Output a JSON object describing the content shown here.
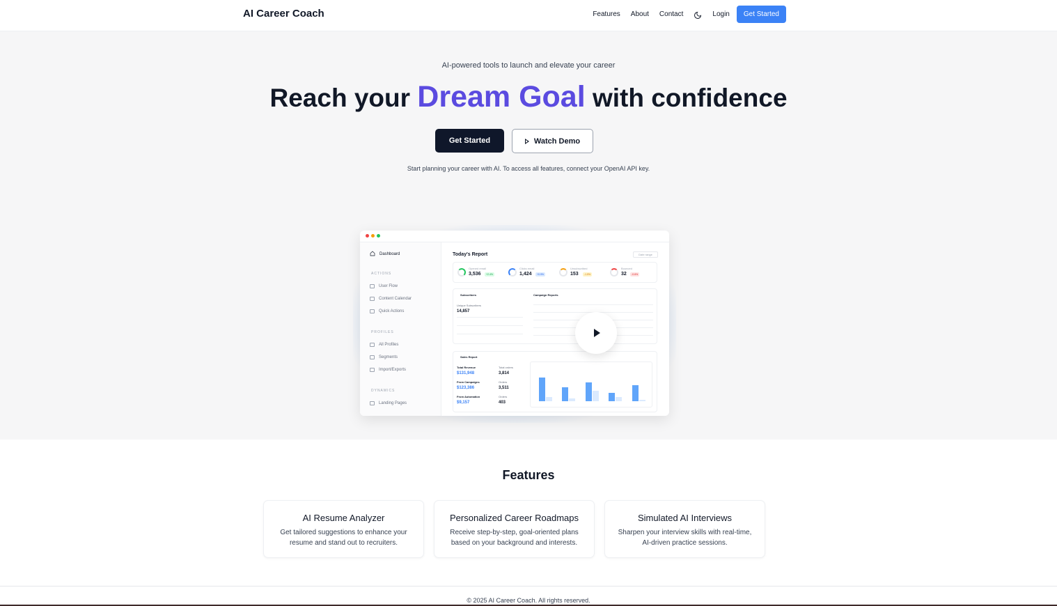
{
  "header": {
    "brand": "AI Career Coach",
    "nav": [
      "Features",
      "About",
      "Contact"
    ],
    "theme_icon": "moon-icon",
    "login": "Login",
    "cta": "Get Started"
  },
  "hero": {
    "tagline": "AI-powered tools to launch and elevate your career",
    "headline_pre": "Reach your",
    "headline_accent": "Dream Goal",
    "headline_post": "with confidence",
    "primary_cta": "Get Started",
    "secondary_cta": "Watch Demo",
    "note": "Start planning your career with AI. To access all features, connect your OpenAI API key."
  },
  "preview": {
    "sidebar": {
      "dashboard": "Dashboard",
      "sections": [
        {
          "title": "ACTIONS",
          "items": [
            "User Flow",
            "Content Calendar",
            "Quick Actions"
          ]
        },
        {
          "title": "PROFILES",
          "items": [
            "All Profiles",
            "Segments",
            "Import/Exports"
          ]
        },
        {
          "title": "DYNAMICS",
          "items": [
            "Landing Pages"
          ]
        }
      ]
    },
    "report_title": "Today's Report",
    "date_chip": "Date range",
    "stats": [
      {
        "label": "Opened email",
        "value": "3,536",
        "change": "+2.4%",
        "color": "#22c55e"
      },
      {
        "label": "Clicks email",
        "value": "1,424",
        "change": "+0.9%",
        "color": "#3b82f6"
      },
      {
        "label": "Unsubscribed",
        "value": "153",
        "change": "-1.5%",
        "color": "#f59e0b"
      },
      {
        "label": "Bounced",
        "value": "32",
        "change": "-0.6%",
        "color": "#ef4444"
      }
    ],
    "subscribers": {
      "title": "Subscribers",
      "total_label": "Unique Subscribers",
      "total": "14,857"
    },
    "campaigns_title": "Campaign Reports",
    "sales": {
      "title": "Sales Report",
      "rows": [
        {
          "label": "Total Revenue",
          "value": "$131,948",
          "sub_label": "Total orders",
          "sub_value": "3,814"
        },
        {
          "label": "From Campaigns",
          "value": "$123,386",
          "sub_label": "Orders",
          "sub_value": "3,511"
        },
        {
          "label": "From Automation",
          "value": "$9,157",
          "sub_label": "Orders",
          "sub_value": "403"
        }
      ]
    }
  },
  "features": {
    "title": "Features",
    "cards": [
      {
        "title": "AI Resume Analyzer",
        "text": "Get tailored suggestions to enhance your resume and stand out to recruiters."
      },
      {
        "title": "Personalized Career Roadmaps",
        "text": "Receive step-by-step, goal-oriented plans based on your background and interests."
      },
      {
        "title": "Simulated AI Interviews",
        "text": "Sharpen your interview skills with real-time, AI-driven practice sessions."
      }
    ]
  },
  "footer": {
    "copyright": "© 2025 AI Career Coach. All rights reserved."
  },
  "colors": {
    "accent": "#5b4be0",
    "primary_blue": "#3b82f6",
    "dark_button": "#0f172a"
  }
}
